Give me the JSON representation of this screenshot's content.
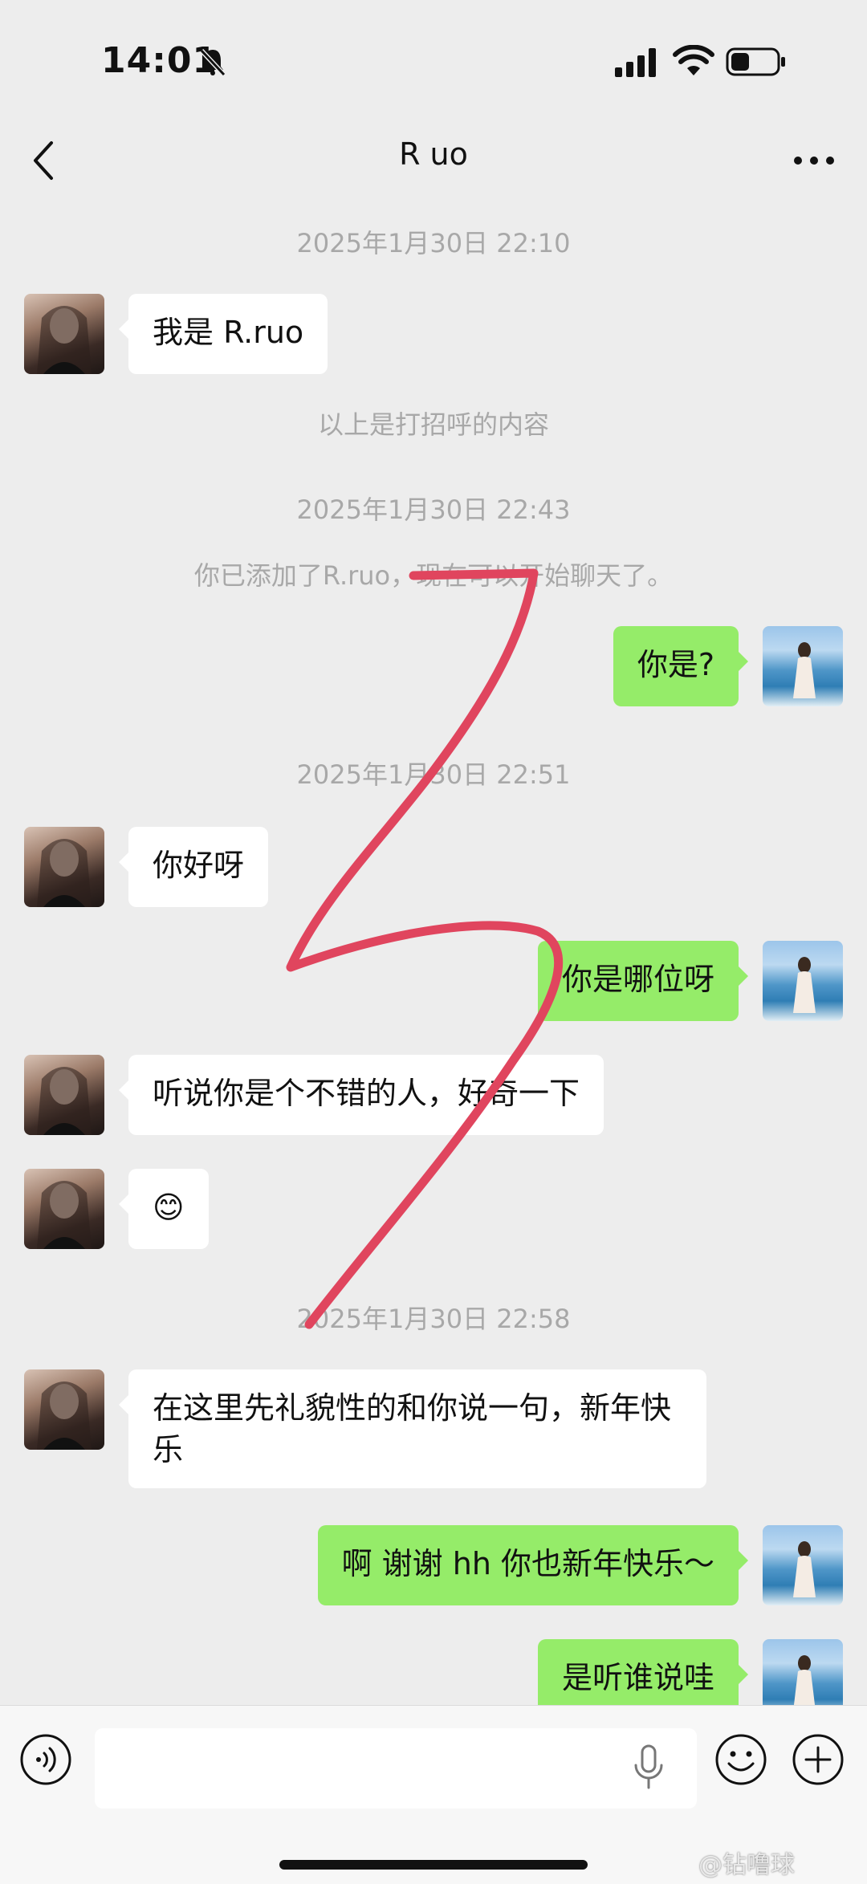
{
  "status_bar": {
    "time": "14:01"
  },
  "header": {
    "title": "R uo"
  },
  "conversation": {
    "timestamps": [
      "2025年1月30日 22:10",
      "2025年1月30日 22:43",
      "2025年1月30日 22:51",
      "2025年1月30日 22:58"
    ],
    "system_notes": [
      "以上是打招呼的内容",
      "你已添加了R.ruo，现在可以开始聊天了。"
    ],
    "messages": [
      {
        "from": "contact",
        "text": "我是 R.ruo"
      },
      {
        "from": "me",
        "text": "你是?"
      },
      {
        "from": "contact",
        "text": "你好呀"
      },
      {
        "from": "me",
        "text": "你是哪位呀"
      },
      {
        "from": "contact",
        "text": "听说你是个不错的人，好奇一下"
      },
      {
        "from": "contact",
        "text": "😊"
      },
      {
        "from": "contact",
        "text": "在这里先礼貌性的和你说一句，新年快乐"
      },
      {
        "from": "me",
        "text": "啊 谢谢 hh 你也新年快乐～"
      },
      {
        "from": "me",
        "text": "是听谁说哇"
      }
    ]
  },
  "input_bar": {
    "value": ""
  },
  "watermark": "@钻噜球",
  "colors": {
    "background": "#ededed",
    "outgoing_bubble": "#95ec69",
    "incoming_bubble": "#ffffff",
    "scribble": "#e0455e"
  }
}
